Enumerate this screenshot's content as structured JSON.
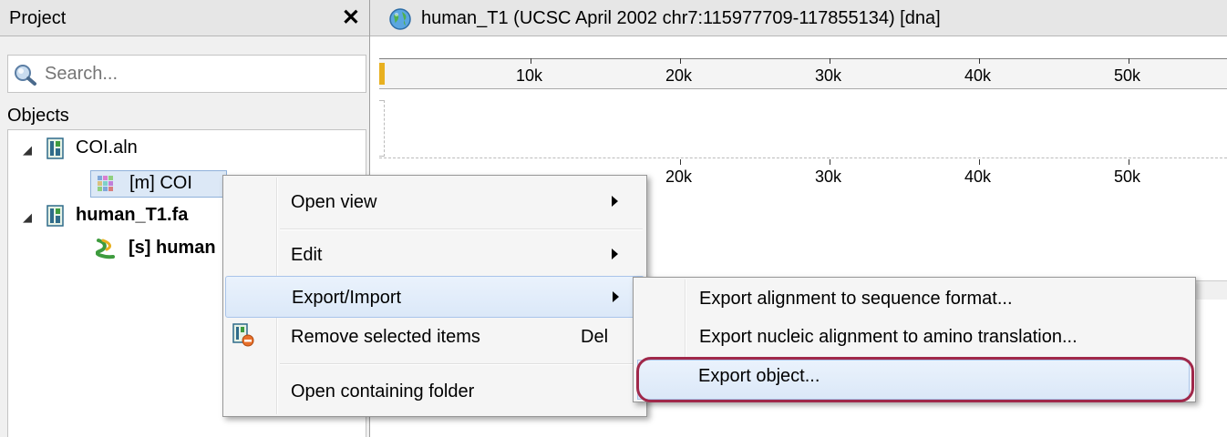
{
  "project_panel": {
    "title": "Project",
    "close": "✕",
    "search_placeholder": "Search...",
    "objects_label": "Objects",
    "tree": {
      "doc1": "COI.aln",
      "obj1": "[m] COI",
      "doc2": "human_T1.fa",
      "obj2": "[s] human"
    }
  },
  "sequence_view": {
    "title": "human_T1 (UCSC April 2002 chr7:115977709-117855134) [dna]",
    "ruler_top_ticks": [
      "10k",
      "20k",
      "30k",
      "40k",
      "50k"
    ],
    "ruler_bottom_ticks": [
      "20k",
      "30k",
      "40k",
      "50k"
    ]
  },
  "context_menu": {
    "items": [
      {
        "label": "Open view",
        "submenu": true
      },
      {
        "label": "Edit",
        "submenu": true
      },
      {
        "label": "Export/Import",
        "submenu": true,
        "highlighted": true
      },
      {
        "label": "Remove selected items",
        "shortcut": "Del"
      },
      {
        "label": "Open containing folder"
      }
    ]
  },
  "submenu": {
    "items": [
      {
        "label": "Export alignment to sequence format..."
      },
      {
        "label": "Export nucleic alignment to amino translation..."
      },
      {
        "label": "Export object...",
        "highlighted": true
      }
    ]
  },
  "colors": {
    "highlight_ring": "#a0284a",
    "selection_bg": "#dce8f6",
    "ruler_marker": "#e8b020"
  }
}
